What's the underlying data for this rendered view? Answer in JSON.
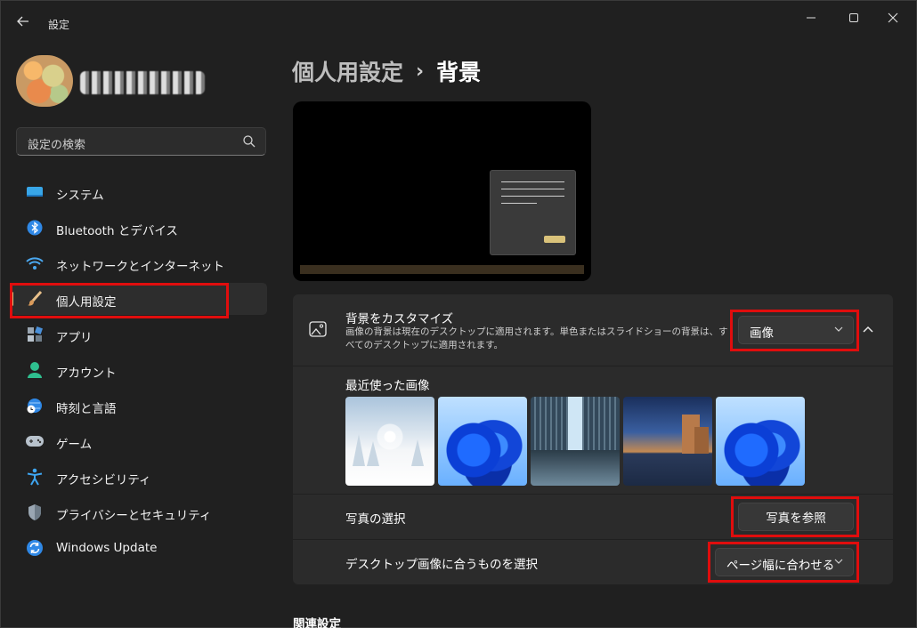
{
  "window": {
    "title": "設定",
    "controls": {
      "minimize": "minimize-icon",
      "maximize": "maximize-icon",
      "close": "close-icon"
    }
  },
  "search": {
    "placeholder": "設定の検索"
  },
  "sidebar": {
    "items": [
      {
        "label": "システム",
        "icon": "system-icon",
        "active": false
      },
      {
        "label": "Bluetooth とデバイス",
        "icon": "bluetooth-icon",
        "active": false
      },
      {
        "label": "ネットワークとインターネット",
        "icon": "wifi-icon",
        "active": false
      },
      {
        "label": "個人用設定",
        "icon": "brush-icon",
        "active": true
      },
      {
        "label": "アプリ",
        "icon": "apps-icon",
        "active": false
      },
      {
        "label": "アカウント",
        "icon": "account-icon",
        "active": false
      },
      {
        "label": "時刻と言語",
        "icon": "time-language-icon",
        "active": false
      },
      {
        "label": "ゲーム",
        "icon": "gamepad-icon",
        "active": false
      },
      {
        "label": "アクセシビリティ",
        "icon": "accessibility-icon",
        "active": false
      },
      {
        "label": "プライバシーとセキュリティ",
        "icon": "shield-icon",
        "active": false
      },
      {
        "label": "Windows Update",
        "icon": "update-icon",
        "active": false
      }
    ]
  },
  "breadcrumb": {
    "parent": "個人用設定",
    "separator": "›",
    "current": "背景"
  },
  "background": {
    "title": "背景をカスタマイズ",
    "description": "画像の背景は現在のデスクトップに適用されます。単色またはスライドショーの背景は、すべてのデスクトップに適用されます。",
    "type_value": "画像",
    "recent_label": "最近使った画像",
    "recent_images": [
      "snowy-forest",
      "windows-bloom",
      "glass-building",
      "castle-dusk",
      "windows-bloom"
    ],
    "choose_label": "写真の選択",
    "browse_button": "写真を参照",
    "fit_label": "デスクトップ画像に合うものを選択",
    "fit_value": "ページ幅に合わせる"
  },
  "related": {
    "title": "関連設定"
  },
  "colors": {
    "accent": "#d9c27a",
    "highlight": "#e00d0d",
    "card": "#2b2b2b",
    "background": "#202020"
  }
}
